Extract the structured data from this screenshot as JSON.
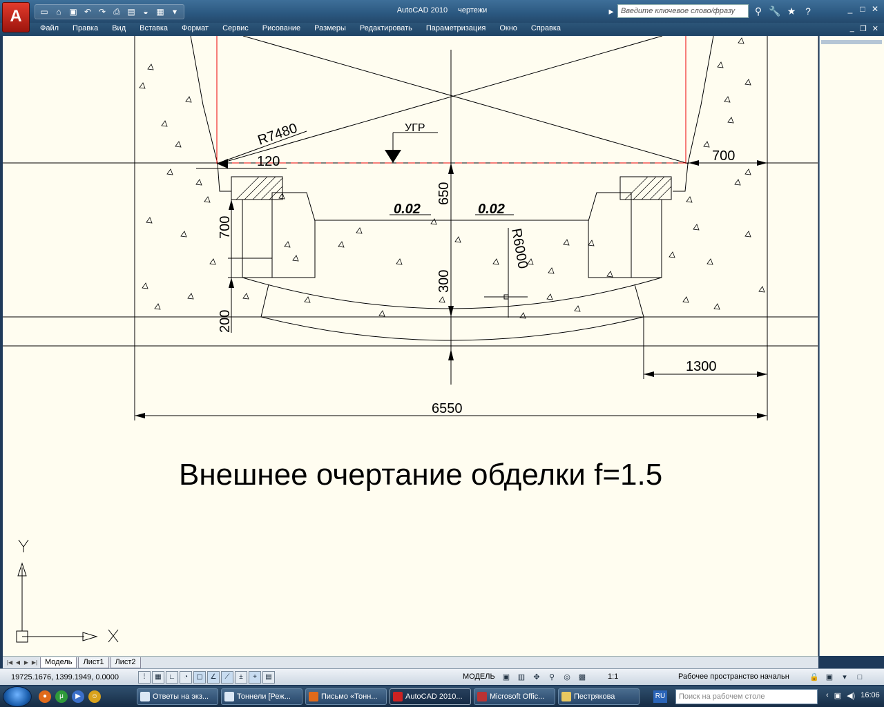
{
  "window": {
    "app_title": "AutoCAD 2010",
    "doc_title": "чертежи",
    "app_button": "A"
  },
  "info_center": {
    "search_placeholder": "Введите ключевое слово/фразу"
  },
  "menu": {
    "items": [
      "Файл",
      "Правка",
      "Вид",
      "Вставка",
      "Формат",
      "Сервис",
      "Рисование",
      "Размеры",
      "Редактировать",
      "Параметризация",
      "Окно",
      "Справка"
    ]
  },
  "drawing": {
    "dims": {
      "r7480": "R7480",
      "d120": "120",
      "d700_top": "700",
      "ugr": "УГР",
      "d650": "650",
      "slope_left": "0.02",
      "slope_right": "0.02",
      "d700_left": "700",
      "r6000": "R6000",
      "d300": "300",
      "d200": "200",
      "d1300": "1300",
      "d6550": "6550"
    },
    "caption": "Внешнее очертание обделки f=1.5",
    "ucs": {
      "y": "Y",
      "x": "X"
    }
  },
  "layout_tabs": [
    "Модель",
    "Лист1",
    "Лист2"
  ],
  "status": {
    "coords": "19725.1676, 1399.1949, 0.0000",
    "model_label": "МОДЕЛЬ",
    "scale": "1:1",
    "workspace": "Рабочее пространство начальн"
  },
  "taskbar": {
    "tasks": [
      "Ответы на экз...",
      "Тоннели [Реж...",
      "Письмо «Тонн...",
      "AutoCAD 2010...",
      "Microsoft Offic...",
      "Пестрякова"
    ],
    "lang": "RU",
    "desktop_search": "Поиск на рабочем столе",
    "clock": "16:06"
  }
}
